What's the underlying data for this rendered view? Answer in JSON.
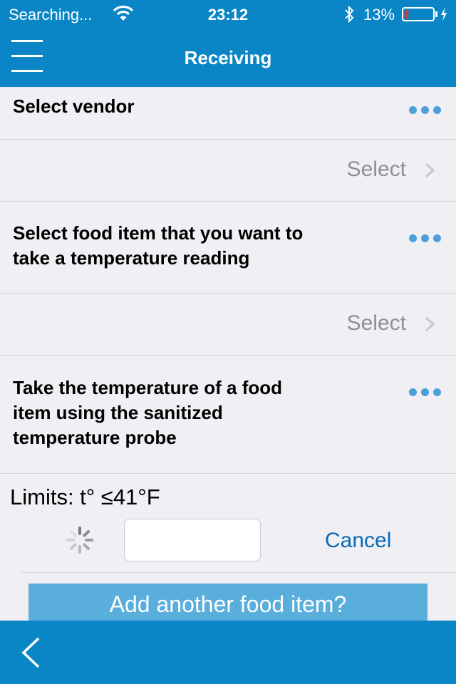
{
  "status_bar": {
    "carrier": "Searching...",
    "time": "23:12",
    "battery_percent": "13%",
    "battery_level": 0.13,
    "icons": [
      "wifi-icon",
      "bluetooth-icon",
      "battery-icon",
      "charging-icon"
    ]
  },
  "nav": {
    "title": "Receiving",
    "menu_icon": "hamburger-menu-icon"
  },
  "steps": [
    {
      "question": "Select vendor",
      "select_label": "Select"
    },
    {
      "question": "Select food item that you want to take a temperature reading",
      "select_label": "Select"
    },
    {
      "question": "Take the temperature of a food item using the sanitized temperature probe"
    }
  ],
  "temperature": {
    "limits": "Limits: t° ≤41°F",
    "value": "",
    "cancel_label": "Cancel"
  },
  "add_another_label": "Add another food item?",
  "toolbar": {
    "back_icon": "chevron-left-icon"
  },
  "colors": {
    "brand_blue": "#0a86c6",
    "button_blue": "#5aaedc",
    "dot_blue": "#4d9fd9",
    "battery_red": "#e8302c",
    "background": "#efeff4"
  }
}
